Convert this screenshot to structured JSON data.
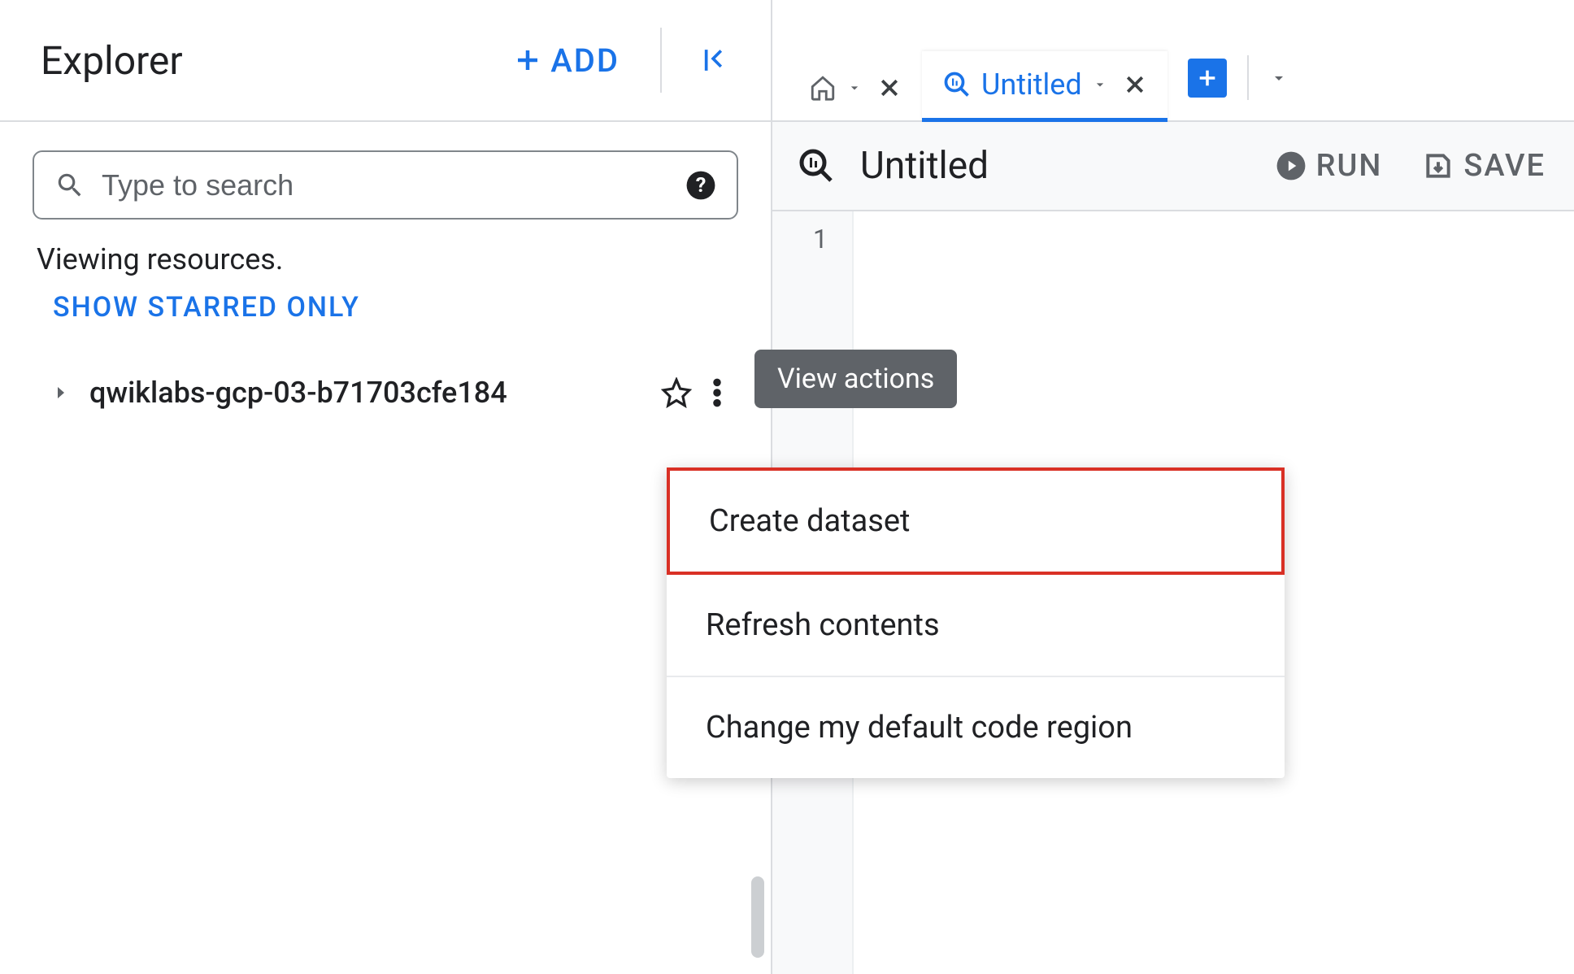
{
  "sidebar": {
    "title": "Explorer",
    "add_label": "ADD",
    "search_placeholder": "Type to search",
    "status_text": "Viewing resources.",
    "starred_link": "SHOW STARRED ONLY",
    "project_name": "qwiklabs-gcp-03-b71703cfe184"
  },
  "tabs": {
    "home": {
      "icon": "home"
    },
    "active": {
      "label": "Untitled",
      "icon": "query"
    }
  },
  "toolbar": {
    "title": "Untitled",
    "run_label": "RUN",
    "save_label": "SAVE"
  },
  "editor": {
    "line_number": "1"
  },
  "tooltip": {
    "text": "View actions"
  },
  "menu": {
    "items": [
      "Create dataset",
      "Refresh contents",
      "Change my default code region"
    ]
  }
}
